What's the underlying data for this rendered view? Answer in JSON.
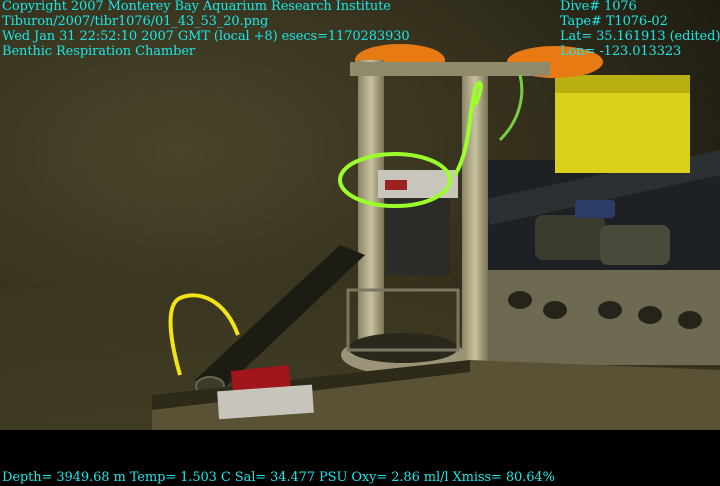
{
  "overlay": {
    "top_left": [
      "Copyright 2007 Monterey Bay Aquarium Research Institute",
      "Tiburon/2007/tibr1076/01_43_53_20.png",
      "Wed Jan 31 22:52:10 2007 GMT (local +8)  esecs=1170283930",
      "Benthic Respiration Chamber"
    ],
    "top_right": [
      "Dive# 1076",
      "Tape# T1076-02",
      "Lat= 35.161913 (edited)",
      "Lon= -123.013323"
    ],
    "bottom": "Depth= 3949.68 m  Temp= 1.503 C  Sal= 34.477 PSU  Oxy= 2.86 ml/l  Xmiss= 80.64%"
  },
  "colors": {
    "text": "#19e8e8",
    "seafloor": "#3f3a22",
    "yellow_housing": "#d8d019",
    "green_tube": "#9cff2c"
  }
}
